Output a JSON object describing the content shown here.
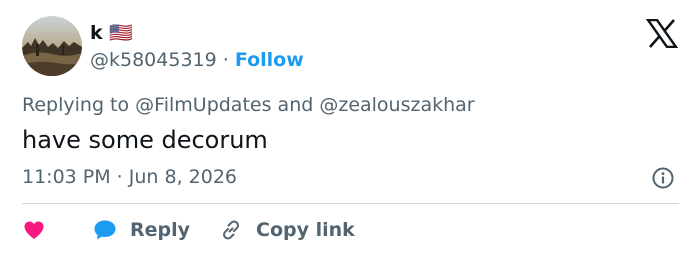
{
  "author": {
    "display_name": "k 🇺🇸",
    "handle": "@k58045319",
    "separator": "·",
    "follow_label": "Follow"
  },
  "reply_context": {
    "prefix": "Replying to",
    "mentions": [
      "@FilmUpdates",
      "@zealouszakhar"
    ],
    "joiner": "and"
  },
  "tweet": {
    "text": "have some decorum",
    "timestamp": "11:03 PM · Jun 8, 2026"
  },
  "actions": {
    "reply_label": "Reply",
    "copy_link_label": "Copy link"
  },
  "icons": {
    "logo": "x-logo-icon",
    "info": "info-icon",
    "like": "heart-icon",
    "reply": "speech-bubble-icon",
    "copy_link": "link-icon"
  },
  "colors": {
    "text_primary": "#0f1419",
    "text_secondary": "#536471",
    "accent": "#1d9bf0",
    "like": "#f91880",
    "divider": "#cfd9de"
  }
}
